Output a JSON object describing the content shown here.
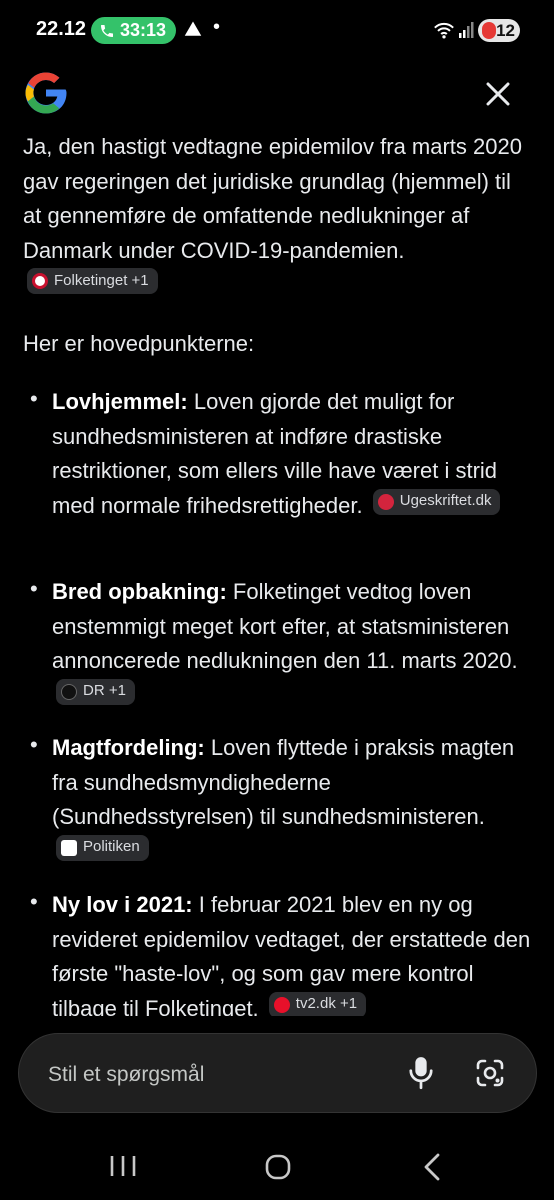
{
  "status": {
    "time": "22.12",
    "call_duration": "33:13",
    "battery": "12"
  },
  "answer": {
    "intro": "Ja, den hastigt vedtagne epidemilov fra marts 2020 gav regeringen det juridiske grundlag (hjemmel) til at gennemføre de omfattende nedlukninger af Danmark under COVID-19-pandemien.",
    "intro_source": "Folketinget +1",
    "points_heading": "Her er hovedpunkterne:",
    "points": [
      {
        "title": "Lovhjemmel:",
        "text": "Loven gjorde det muligt for sundhedsministeren at indføre drastiske restriktioner, som ellers ville have været i strid med normale frihedsrettigheder.",
        "source": "Ugeskriftet.dk"
      },
      {
        "title": "Bred opbakning:",
        "text": "Folketinget vedtog loven enstemmigt meget kort efter, at statsministeren annoncerede nedlukningen den 11. marts 2020.",
        "source": "DR +1"
      },
      {
        "title": "Magtfordeling:",
        "text": "Loven flyttede i praksis magten fra sundhedsmyndighederne (Sundhedsstyrelsen) til sundhedsministeren.",
        "source": "Politiken"
      },
      {
        "title": "Ny lov i 2021:",
        "text": "I februar 2021 blev en ny og revideret epidemilov vedtaget, der erstattede den første \"haste-lov\", og som gav mere kontrol tilbage til Folketinget.",
        "source": "tv2.dk +1"
      }
    ]
  },
  "input": {
    "placeholder": "Stil et spørgsmål"
  },
  "colors": {
    "background": "#000000",
    "text": "#e8eaed",
    "chip_bg": "#2b2c2f",
    "call_green": "#34c26a"
  }
}
